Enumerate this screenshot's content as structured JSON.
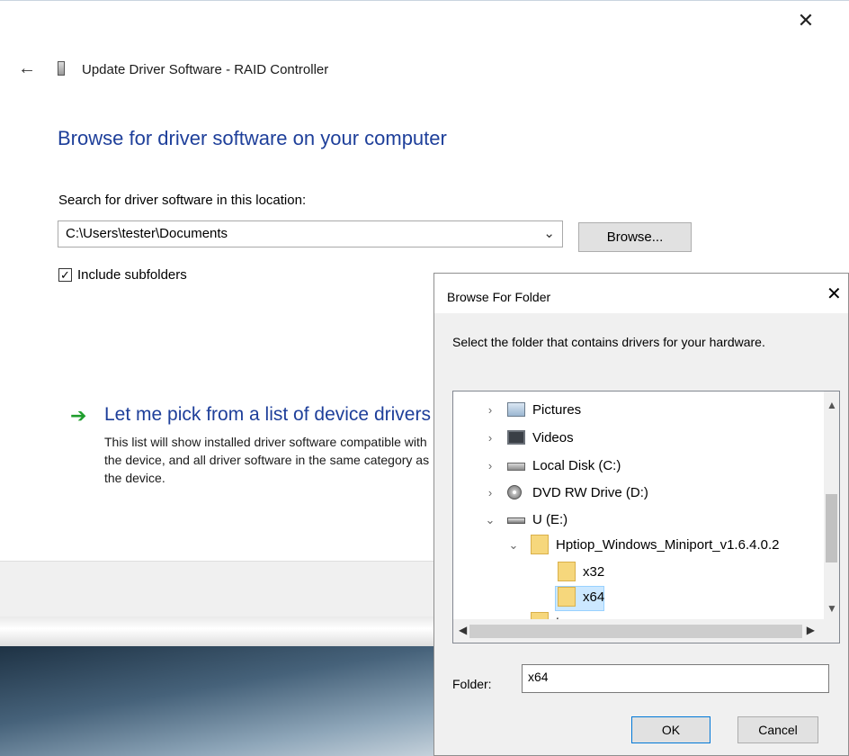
{
  "wizard": {
    "close_glyph": "✕",
    "back_glyph": "←",
    "title": "Update Driver Software - RAID Controller",
    "heading": "Browse for driver software on your computer",
    "search_label": "Search for driver software in this location:",
    "path_value": "C:\\Users\\tester\\Documents",
    "browse_label": "Browse...",
    "include_subfolders_label": "Include subfolders",
    "include_subfolders_checked": true,
    "pick_title": "Let me pick from a list of device drivers on my computer",
    "pick_description": "This list will show installed driver software compatible with the device, and all driver software in the same category as the device."
  },
  "dialog": {
    "title": "Browse For Folder",
    "close_glyph": "✕",
    "prompt": "Select the folder that contains drivers for your hardware.",
    "tree": [
      {
        "label": "Pictures",
        "expander": "›",
        "icon": "pictures-folder-icon"
      },
      {
        "label": "Videos",
        "expander": "›",
        "icon": "videos-folder-icon"
      },
      {
        "label": "Local Disk (C:)",
        "expander": "›",
        "icon": "local-disk-icon"
      },
      {
        "label": "DVD RW Drive (D:)",
        "expander": "›",
        "icon": "dvd-drive-icon"
      },
      {
        "label": "U (E:)",
        "expander": "⌄",
        "icon": "usb-drive-icon"
      },
      {
        "label": "Hptiop_Windows_Miniport_v1.6.4.0.2",
        "expander": "⌄",
        "icon": "folder-icon"
      },
      {
        "label": "x32",
        "expander": "",
        "icon": "folder-icon"
      },
      {
        "label": "x64",
        "expander": "",
        "icon": "folder-icon",
        "selected": true
      },
      {
        "label": "tmp",
        "expander": "›",
        "icon": "folder-icon"
      }
    ],
    "folder_label": "Folder:",
    "folder_value": "x64",
    "ok_label": "OK",
    "cancel_label": "Cancel"
  },
  "colors": {
    "heading_blue": "#1e3f9a",
    "arrow_green": "#1f9e2d",
    "selection": "#cce8ff"
  }
}
